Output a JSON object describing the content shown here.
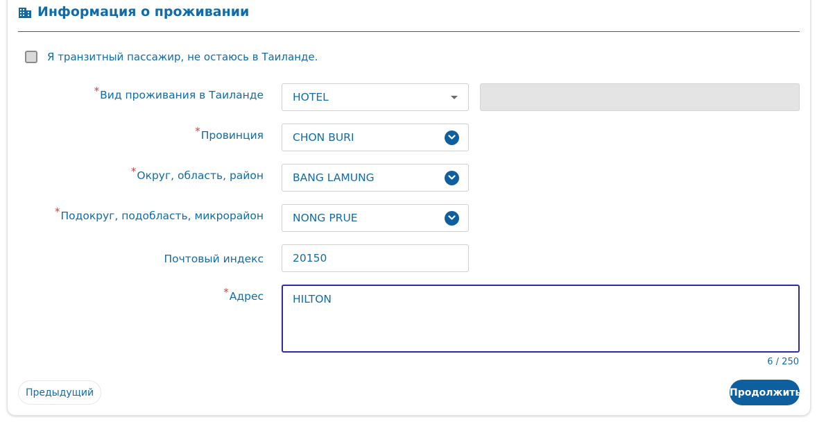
{
  "section": {
    "title": "Информация о проживании",
    "icon": "building-icon"
  },
  "transit": {
    "checked": false,
    "label": "Я транзитный пассажир, не остаюсь в Таиланде."
  },
  "form": {
    "accommodation_type": {
      "required_mark": "*",
      "label": "Вид проживания в Таиланде",
      "value": "HOTEL"
    },
    "province": {
      "required_mark": "*",
      "label": "Провинция",
      "value": "CHON BURI"
    },
    "district": {
      "required_mark": "*",
      "label": "Округ, область, район",
      "value": "BANG LAMUNG"
    },
    "subdistrict": {
      "required_mark": "*",
      "label": "Подокруг, подобласть, микрорайон",
      "value": "NONG PRUE"
    },
    "postal_code": {
      "label": "Почтовый индекс",
      "value": "20150"
    },
    "address": {
      "required_mark": "*",
      "label": "Адрес",
      "value": "HILTON",
      "counter": "6 / 250"
    }
  },
  "buttons": {
    "previous": "Предыдущий",
    "continue": "Продолжить"
  },
  "colors": {
    "accent": "#0f6ca8",
    "required": "#e53935",
    "focus_border": "#2c2c9e"
  }
}
